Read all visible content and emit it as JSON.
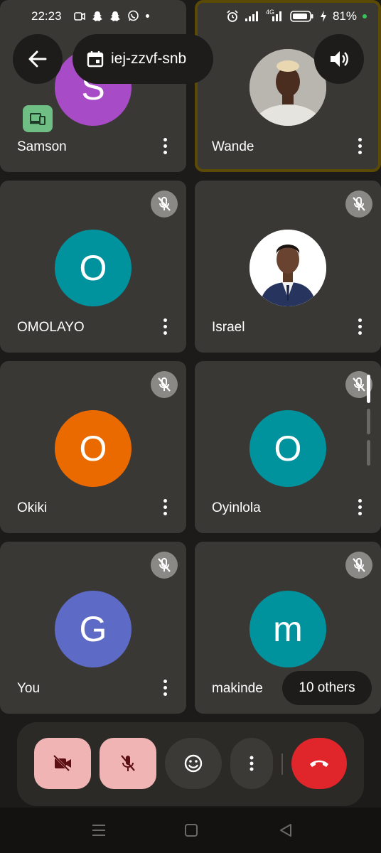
{
  "status_bar": {
    "time": "22:23",
    "battery_percent": "81%",
    "network": "4G",
    "left_icons": [
      "video-icon",
      "snapchat-icon",
      "snapchat-icon",
      "whatsapp-icon",
      "dot-icon"
    ],
    "right_icons": [
      "alarm-icon",
      "signal-icon",
      "signal-4g-icon",
      "battery-icon",
      "charging-icon",
      "green-dot-icon"
    ]
  },
  "header": {
    "back_icon": "arrow-left-icon",
    "meeting_code": "iej-zzvf-snb",
    "calendar_icon": "calendar-icon",
    "speaker_icon": "speaker-icon"
  },
  "participants": [
    {
      "name": "Samson",
      "initial": "S",
      "color": "#a84bc6",
      "muted": false,
      "casting": true
    },
    {
      "name": "Wande",
      "initial": "",
      "color": "#c7c7c7",
      "muted": false,
      "active_speaker": true,
      "photo": true
    },
    {
      "name": "OMOLAYO",
      "initial": "O",
      "color": "#00939e",
      "muted": true
    },
    {
      "name": "Israel",
      "initial": "",
      "color": "#ffffff",
      "muted": true,
      "photo": true
    },
    {
      "name": "Okiki",
      "initial": "O",
      "color": "#eb6a00",
      "muted": true
    },
    {
      "name": "Oyinlola",
      "initial": "O",
      "color": "#00939e",
      "muted": true
    },
    {
      "name": "You",
      "initial": "G",
      "color": "#5d6bc7",
      "muted": true
    },
    {
      "name": "makinde",
      "initial": "m",
      "color": "#00939e",
      "muted": true
    }
  ],
  "others_label": "10 others",
  "controls": {
    "camera_icon": "camera-off-icon",
    "mic_icon": "mic-off-icon",
    "reactions_icon": "emoji-icon",
    "more_icon": "more-vertical-icon",
    "hangup_icon": "hang-up-icon",
    "camera_bg": "#f1b4b4",
    "mic_bg": "#f1b4b4",
    "hangup_bg": "#e0262b"
  },
  "nav_bar": {
    "icons": [
      "menu-icon",
      "home-icon",
      "back-icon"
    ]
  }
}
